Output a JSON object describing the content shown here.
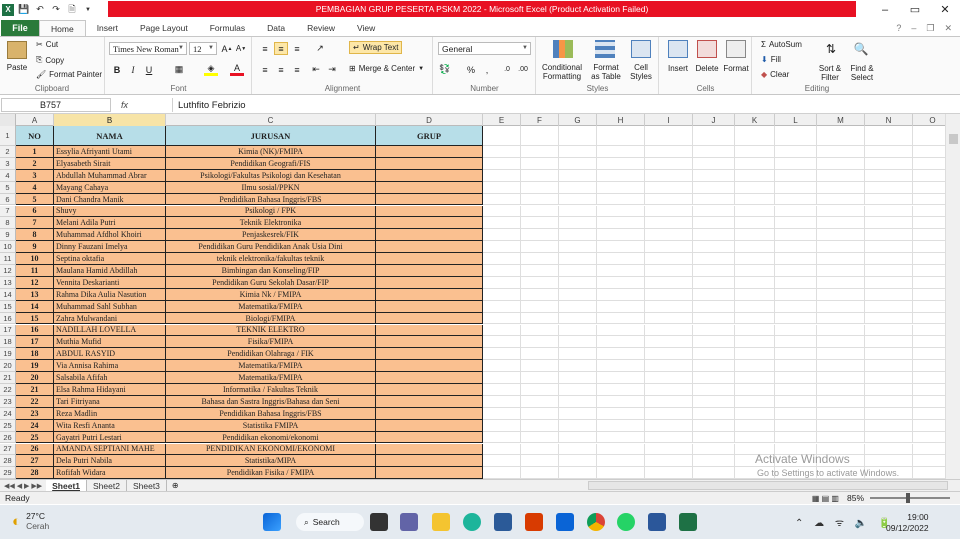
{
  "window": {
    "title": "PEMBAGIAN GRUP PESERTA PSKM 2022  -  Microsoft Excel (Product Activation Failed)",
    "controls": [
      "–",
      "▭",
      "✕"
    ]
  },
  "tabs": {
    "file": "File",
    "items": [
      "Home",
      "Insert",
      "Page Layout",
      "Formulas",
      "Data",
      "Review",
      "View"
    ]
  },
  "ribbon": {
    "clipboard": {
      "label": "Clipboard",
      "paste": "Paste",
      "cut": "Cut",
      "copy": "Copy",
      "format_painter": "Format Painter"
    },
    "font": {
      "label": "Font",
      "name": "Times New Roman",
      "size": "12",
      "bold": "B",
      "italic": "I",
      "underline": "U"
    },
    "alignment": {
      "label": "Alignment",
      "wrap": "Wrap Text",
      "merge": "Merge & Center"
    },
    "number": {
      "label": "Number",
      "format": "General"
    },
    "styles": {
      "label": "Styles",
      "conditional": "Conditional",
      "conditional2": "Formatting",
      "format_table": "Format",
      "format_table2": "as Table",
      "cell_styles": "Cell",
      "cell_styles2": "Styles"
    },
    "cells": {
      "label": "Cells",
      "insert": "Insert",
      "delete": "Delete",
      "format": "Format"
    },
    "editing": {
      "label": "Editing",
      "autosum": "AutoSum",
      "fill": "Fill",
      "clear": "Clear",
      "sort": "Sort &",
      "sort2": "Filter",
      "find": "Find &",
      "find2": "Select"
    }
  },
  "formula_bar": {
    "name_box": "B757",
    "fx": "fx",
    "value": "Luthfito Febrizio"
  },
  "columns": [
    "A",
    "B",
    "C",
    "D",
    "E",
    "F",
    "G",
    "H",
    "I",
    "J",
    "K",
    "L",
    "M",
    "N",
    "O"
  ],
  "header": {
    "no": "NO",
    "nama": "NAMA",
    "jurusan": "JURUSAN",
    "grup": "GRUP"
  },
  "rows": [
    {
      "no": "1",
      "nama": "Essylia Afriyanti Utami",
      "jurusan": "Kimia (NK)/FMIPA"
    },
    {
      "no": "2",
      "nama": "Elyasabeth Sirait",
      "jurusan": "Pendidikan Geografi/FIS"
    },
    {
      "no": "3",
      "nama": "Abdullah Muhammad Abrar",
      "jurusan": "Psikologi/Fakultas Psikologi dan Kesehatan"
    },
    {
      "no": "4",
      "nama": "Mayang Cahaya",
      "jurusan": "Ilmu sosial/PPKN"
    },
    {
      "no": "5",
      "nama": "Dani Chandra Manik",
      "jurusan": "Pendidikan Bahasa Inggris/FBS"
    },
    {
      "no": "6",
      "nama": "Shuvy",
      "jurusan": "Psikologi / FPK"
    },
    {
      "no": "7",
      "nama": "Melani Adila Putri",
      "jurusan": "Teknik Elektronika"
    },
    {
      "no": "8",
      "nama": "Muhammad Afdhol Khoiri",
      "jurusan": "Penjaskesrek/FIK"
    },
    {
      "no": "9",
      "nama": "Dinny Fauzani Imelya",
      "jurusan": "Pendidikan Guru Pendidikan Anak Usia Dini"
    },
    {
      "no": "10",
      "nama": "Septina oktafia",
      "jurusan": "teknik elektronika/fakultas teknik"
    },
    {
      "no": "11",
      "nama": "Maulana Hamid Abdillah",
      "jurusan": "Bimbingan dan Konseling/FIP"
    },
    {
      "no": "12",
      "nama": "Vennita Deskarianti",
      "jurusan": "Pendidikan Guru Sekolah Dasar/FIP"
    },
    {
      "no": "13",
      "nama": "Rahma Dika Aulia Nasution",
      "jurusan": "Kimia Nk / FMIPA"
    },
    {
      "no": "14",
      "nama": "Muhammad Sahl Subhan",
      "jurusan": "Matematika/FMIPA"
    },
    {
      "no": "15",
      "nama": "Zahra Mulwandani",
      "jurusan": "Biologi/FMIPA"
    },
    {
      "no": "16",
      "nama": "NADILLAH LOVELLA",
      "jurusan": "TEKNIK ELEKTRO"
    },
    {
      "no": "17",
      "nama": "Muthia Mufid",
      "jurusan": "Fisika/FMIPA"
    },
    {
      "no": "18",
      "nama": "ABDUL RASYID",
      "jurusan": "Pendidikan Olahraga / FIK"
    },
    {
      "no": "19",
      "nama": "Via Annisa Rahima",
      "jurusan": "Matematika/FMIPA"
    },
    {
      "no": "20",
      "nama": "Salsabila Afifah",
      "jurusan": "Matematika/FMIPA"
    },
    {
      "no": "21",
      "nama": "Elsa Rahma Hidayani",
      "jurusan": "Informatika / Fakultas Teknik"
    },
    {
      "no": "22",
      "nama": "Tari Fitriyana",
      "jurusan": "Bahasa dan Sastra Inggris/Bahasa dan Seni"
    },
    {
      "no": "23",
      "nama": "Reza Madlin",
      "jurusan": "Pendidikan Bahasa Inggris/FBS"
    },
    {
      "no": "24",
      "nama": "Wita Resfi Ananta",
      "jurusan": "Statistika FMIPA"
    },
    {
      "no": "25",
      "nama": "Gayatri Putri Lestari",
      "jurusan": "Pendidikan ekonomi/ekonomi"
    },
    {
      "no": "26",
      "nama": "AMANDA SEPTIANI MAHE",
      "jurusan": "PENDIDIKAN EKONOMI/EKONOMI"
    },
    {
      "no": "27",
      "nama": "Dela Putri Nabila",
      "jurusan": "Statistika/MIPA"
    },
    {
      "no": "28",
      "nama": "Rofifah Widara",
      "jurusan": "Pendidikan Fisika / FMIPA"
    }
  ],
  "sheets": [
    "Sheet1",
    "Sheet2",
    "Sheet3"
  ],
  "status": {
    "text": "Ready",
    "zoom": "85%"
  },
  "watermark": {
    "title": "Activate Windows",
    "sub": "Go to Settings to activate Windows."
  },
  "taskbar": {
    "weather_temp": "27°C",
    "weather_desc": "Cerah",
    "search": "Search",
    "time": "19:00",
    "date": "09/12/2022"
  },
  "colors": {
    "header_fill": "#b7dee8",
    "data_fill": "#fac090",
    "title_red": "#e81123",
    "file_green": "#2a7a3a"
  }
}
